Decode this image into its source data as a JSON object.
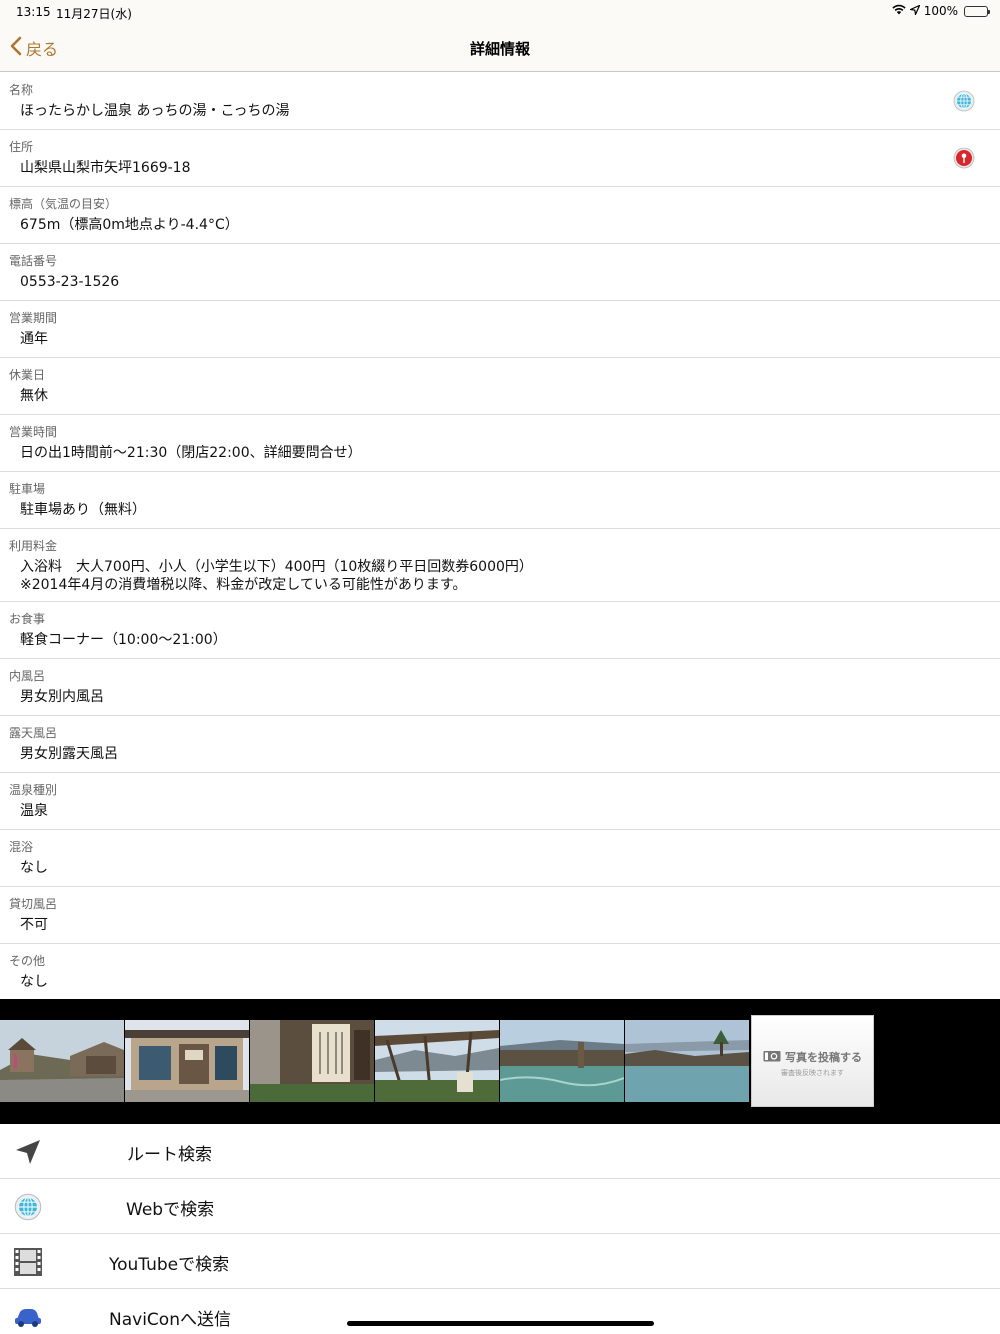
{
  "status_bar": {
    "time": "13:15",
    "date": "11月27日(水)",
    "battery": "100%"
  },
  "nav": {
    "back_label": "戻る",
    "title": "詳細情報"
  },
  "details": [
    {
      "label": "名称",
      "value": "ほったらかし温泉 あっちの湯・こっちの湯",
      "icon": "globe-icon"
    },
    {
      "label": "住所",
      "value": "山梨県山梨市矢坪1669-18",
      "icon": "map-pin-icon"
    },
    {
      "label": "標高（気温の目安）",
      "value": "675m（標高0m地点より-4.4°C）"
    },
    {
      "label": "電話番号",
      "value": "0553-23-1526"
    },
    {
      "label": "営業期間",
      "value": "通年"
    },
    {
      "label": "休業日",
      "value": "無休"
    },
    {
      "label": "営業時間",
      "value": "日の出1時間前～21:30（閉店22:00、詳細要問合せ）"
    },
    {
      "label": "駐車場",
      "value": "駐車場あり（無料）"
    },
    {
      "label": "利用料金",
      "value": "入浴料　大人700円、小人（小学生以下）400円（10枚綴り平日回数券6000円）\n※2014年4月の消費増税以降、料金が改定している可能性があります。"
    },
    {
      "label": "お食事",
      "value": "軽食コーナー（10:00～21:00）"
    },
    {
      "label": "内風呂",
      "value": "男女別内風呂"
    },
    {
      "label": "露天風呂",
      "value": "男女別露天風呂"
    },
    {
      "label": "温泉種別",
      "value": "温泉"
    },
    {
      "label": "混浴",
      "value": "なし"
    },
    {
      "label": "貸切風呂",
      "value": "不可"
    },
    {
      "label": "その他",
      "value": "なし"
    }
  ],
  "photo_post": {
    "label": "写真を投稿する",
    "sublabel": "審査後反映されます"
  },
  "actions": [
    {
      "label": "ルート検索",
      "icon": "navigation-arrow-icon"
    },
    {
      "label": "Webで検索",
      "icon": "globe-icon"
    },
    {
      "label": "YouTubeで検索",
      "icon": "film-icon"
    },
    {
      "label": "NaviConへ送信",
      "icon": "car-icon"
    }
  ],
  "colors": {
    "accent": "#b0762e",
    "bar_background": "#fbfaf7",
    "separator": "#dcdcdc"
  }
}
